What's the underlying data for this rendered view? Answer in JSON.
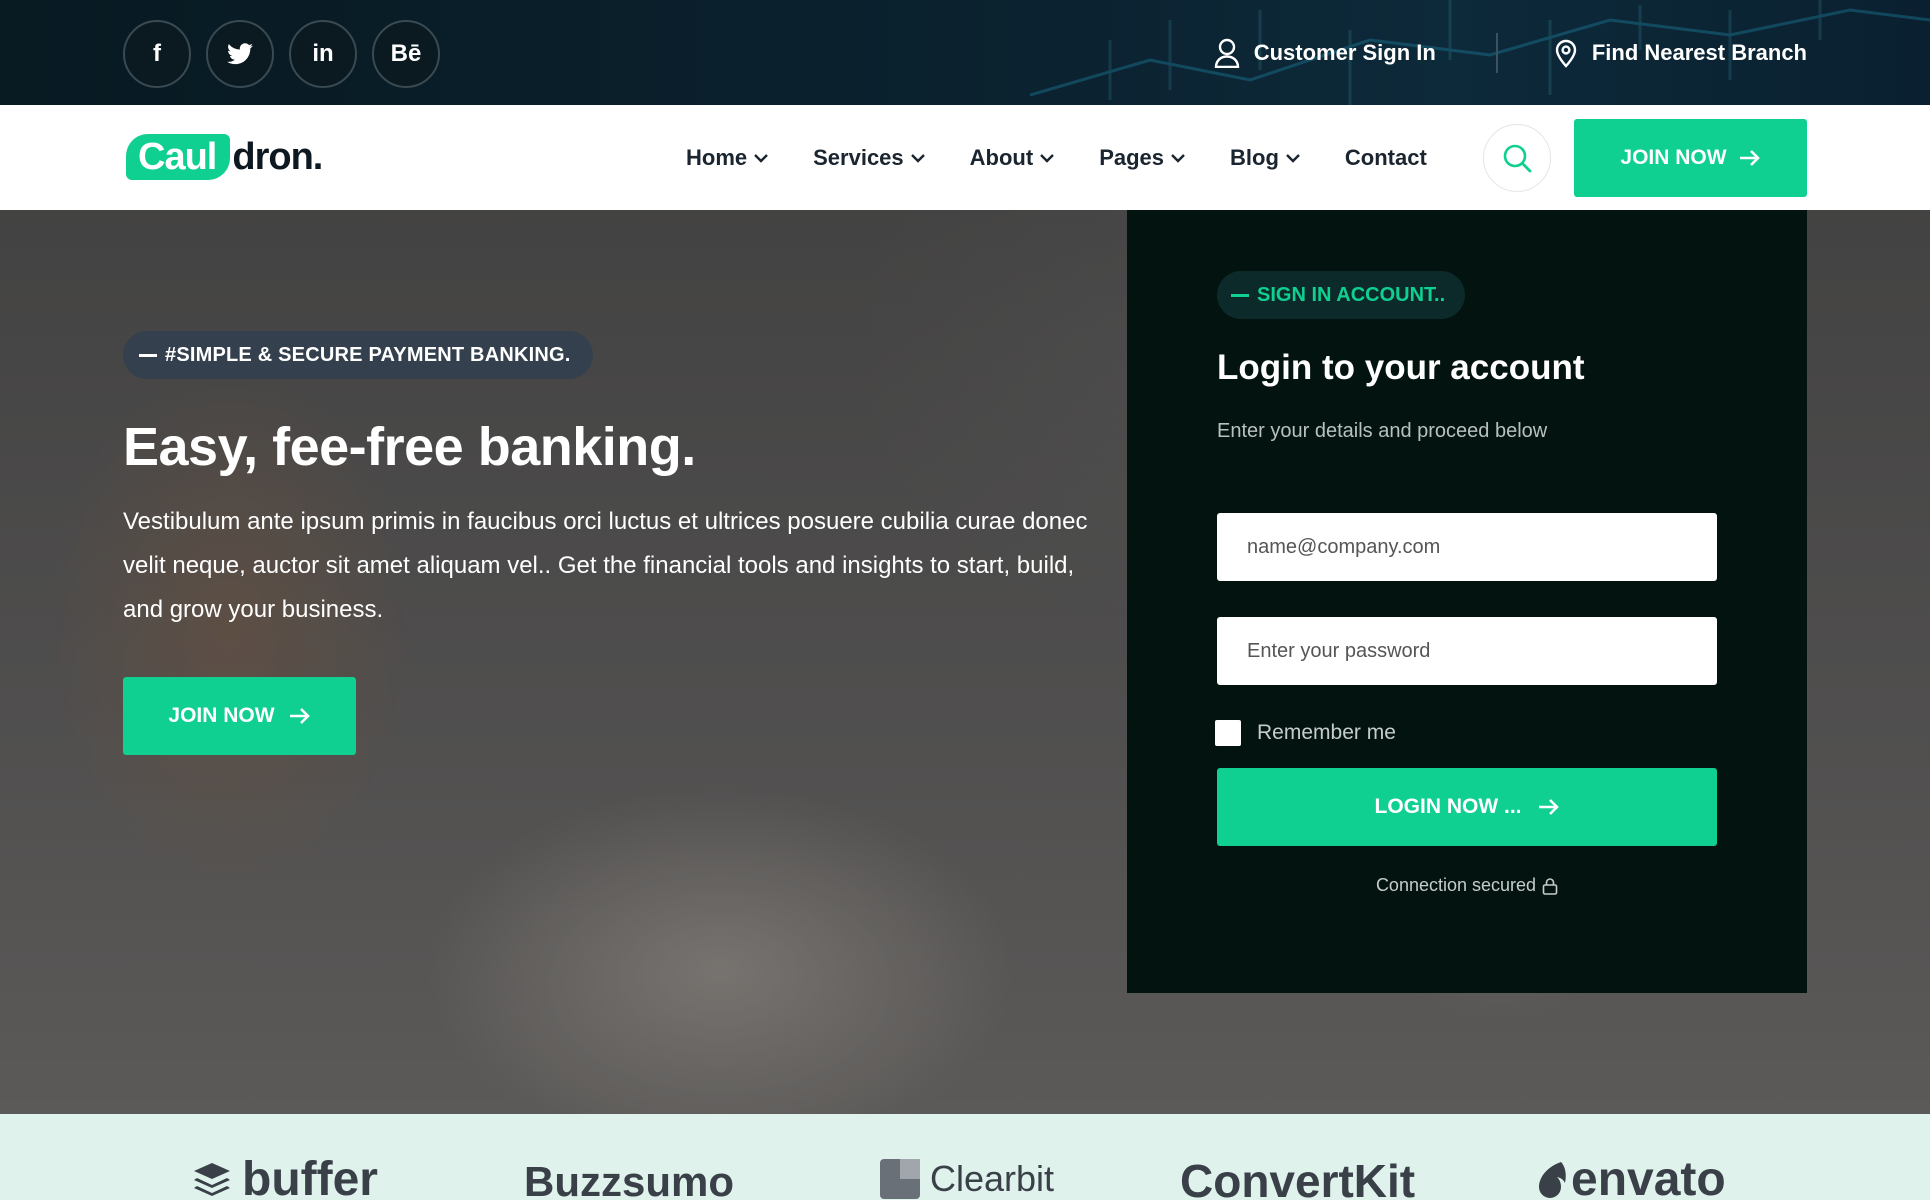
{
  "topbar": {
    "socials": [
      {
        "name": "facebook",
        "label": "f"
      },
      {
        "name": "twitter",
        "label": ""
      },
      {
        "name": "linkedin",
        "label": "in"
      },
      {
        "name": "behance",
        "label": "Bē"
      }
    ],
    "customer_sign_in": "Customer Sign In",
    "find_branch": "Find Nearest Branch"
  },
  "nav": {
    "logo_part1": "Caul",
    "logo_part2": "dron.",
    "items": [
      {
        "label": "Home",
        "dropdown": true
      },
      {
        "label": "Services",
        "dropdown": true
      },
      {
        "label": "About",
        "dropdown": true
      },
      {
        "label": "Pages",
        "dropdown": true
      },
      {
        "label": "Blog",
        "dropdown": true
      },
      {
        "label": "Contact",
        "dropdown": false
      }
    ],
    "join_label": "JOIN NOW"
  },
  "hero": {
    "badge": "#SIMPLE & SECURE PAYMENT BANKING.",
    "title": "Easy, fee-free banking.",
    "text": "Vestibulum ante ipsum primis in faucibus orci luctus et ultrices posuere cubilia curae donec velit neque, auctor sit amet aliquam vel.. Get the financial tools and insights to start, build, and grow your business.",
    "join_label": "JOIN NOW"
  },
  "login": {
    "badge": "SIGN IN ACCOUNT..",
    "title": "Login to your account",
    "subtitle": "Enter your details and proceed below",
    "email_placeholder": "name@company.com",
    "password_placeholder": "Enter your password",
    "remember_label": "Remember me",
    "remember_checked": false,
    "button_label": "LOGIN NOW ...",
    "secured_text": "Connection secured"
  },
  "brands": [
    "buffer",
    "Buzzsumo",
    "Clearbit",
    "ConvertKit",
    "envato"
  ],
  "colors": {
    "accent": "#0fcf91",
    "topbar": "#081a22",
    "login_card": "#031410",
    "brand_strip": "#dff3ec"
  }
}
